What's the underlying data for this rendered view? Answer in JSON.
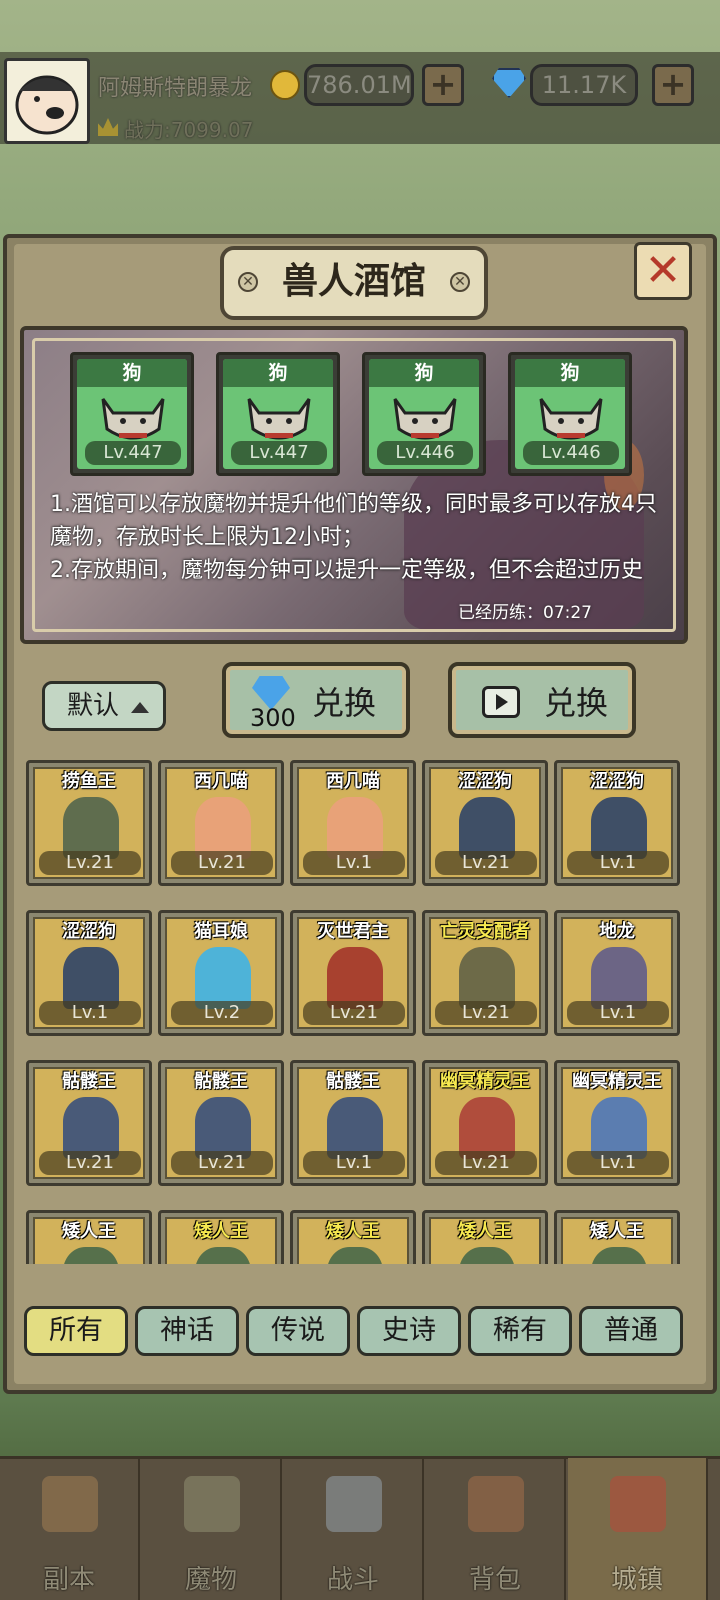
{
  "player": {
    "name": "阿姆斯特朗暴龙",
    "gold": "786.01M",
    "gems": "11.17K",
    "power": "战力:7099.07",
    "plus": "+"
  },
  "panel": {
    "title": "兽人酒馆",
    "close": "✕"
  },
  "stored": [
    {
      "name": "狗",
      "level": "Lv.447"
    },
    {
      "name": "狗",
      "level": "Lv.447"
    },
    {
      "name": "狗",
      "level": "Lv.446"
    },
    {
      "name": "狗",
      "level": "Lv.446"
    }
  ],
  "info": {
    "line1": "1.酒馆可以存放魔物并提升他们的等级，同时最多可以存放4只魔物，存放时长上限为12小时；",
    "line2": "2.存放期间，魔物每分钟可以提升一定等级，但不会超过历史",
    "elapsed": "已经历练：07:27"
  },
  "controls": {
    "sort_label": "默认",
    "exchange_gem_label": "兑换",
    "exchange_gem_cost": "300",
    "exchange_ad_label": "兑换"
  },
  "monsters": [
    {
      "name": "捞鱼王",
      "level": "Lv.21",
      "gold": false,
      "color": "#5f6d4e"
    },
    {
      "name": "西几喵",
      "level": "Lv.21",
      "gold": false,
      "color": "#e8a278"
    },
    {
      "name": "西几喵",
      "level": "Lv.1",
      "gold": false,
      "color": "#e8a278"
    },
    {
      "name": "涩涩狗",
      "level": "Lv.21",
      "gold": false,
      "color": "#3f4f66"
    },
    {
      "name": "涩涩狗",
      "level": "Lv.1",
      "gold": false,
      "color": "#3f4f66"
    },
    {
      "name": "涩涩狗",
      "level": "Lv.1",
      "gold": false,
      "color": "#3f4f66"
    },
    {
      "name": "猫耳娘",
      "level": "Lv.2",
      "gold": false,
      "color": "#4eb3d8"
    },
    {
      "name": "灭世君主",
      "level": "Lv.21",
      "gold": false,
      "color": "#a8412f"
    },
    {
      "name": "亡灵支配者",
      "level": "Lv.21",
      "gold": true,
      "color": "#6d6a48"
    },
    {
      "name": "地龙",
      "level": "Lv.1",
      "gold": false,
      "color": "#6c6585"
    },
    {
      "name": "骷髅王",
      "level": "Lv.21",
      "gold": false,
      "color": "#495a78"
    },
    {
      "name": "骷髅王",
      "level": "Lv.21",
      "gold": false,
      "color": "#495a78"
    },
    {
      "name": "骷髅王",
      "level": "Lv.1",
      "gold": false,
      "color": "#495a78"
    },
    {
      "name": "幽冥精灵王",
      "level": "Lv.21",
      "gold": true,
      "color": "#b04d3c"
    },
    {
      "name": "幽冥精灵王",
      "level": "Lv.1",
      "gold": false,
      "color": "#5b7db0"
    },
    {
      "name": "矮人王",
      "level": "",
      "gold": false,
      "color": "#56704b"
    },
    {
      "name": "矮人王",
      "level": "",
      "gold": true,
      "color": "#56704b"
    },
    {
      "name": "矮人王",
      "level": "",
      "gold": true,
      "color": "#56704b"
    },
    {
      "name": "矮人王",
      "level": "",
      "gold": true,
      "color": "#56704b"
    },
    {
      "name": "矮人王",
      "level": "",
      "gold": false,
      "color": "#56704b"
    }
  ],
  "filters": [
    "所有",
    "神话",
    "传说",
    "史诗",
    "稀有",
    "普通"
  ],
  "nav": [
    "副本",
    "魔物",
    "战斗",
    "背包",
    "城镇"
  ]
}
